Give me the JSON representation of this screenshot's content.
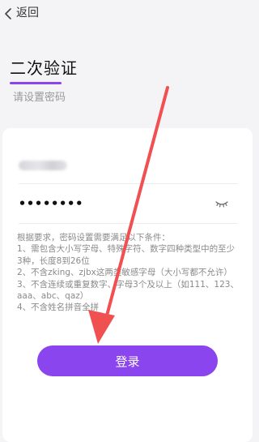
{
  "header": {
    "back_label": "返回"
  },
  "page": {
    "title": "二次验证",
    "subtitle": "请设置密码"
  },
  "form": {
    "password_value": "••••••••",
    "requirements": "根据要求，密码设置需要满足以下条件：\n1、需包含大小写字母、特殊字符、数字四种类型中的至少3种，长度8到26位\n2、不含zking、zjbx这两类敏感字母（大小写都不允许）\n3、不含连续或重复数字、字母3个及以上（如111、123、aaa、abc、qaz）\n4、不含姓名拼音全拼",
    "submit_label": "登录"
  },
  "icons": {
    "back": "chevron-left-icon",
    "eye": "eye-closed-icon"
  },
  "colors": {
    "accent": "#8b45ef",
    "annotation_arrow": "#f05050",
    "background": "#f4f4f6"
  }
}
